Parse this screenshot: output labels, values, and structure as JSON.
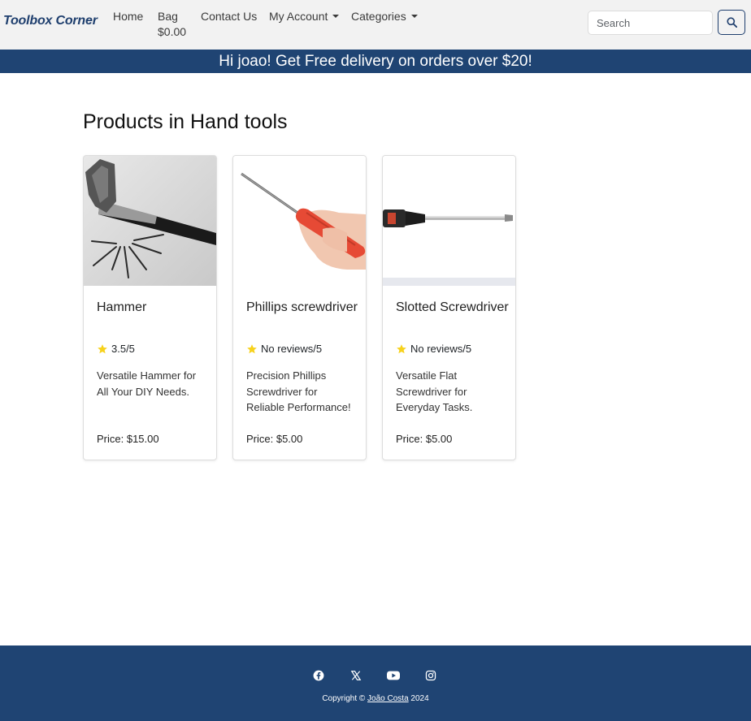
{
  "navbar": {
    "brand": "Toolbox Corner",
    "links": {
      "home": "Home",
      "bag": "Bag",
      "bag_total": "$0.00",
      "contact": "Contact Us",
      "account": "My Account",
      "categories": "Categories"
    },
    "search": {
      "placeholder": "Search",
      "value": ""
    },
    "search_icon": "search-icon"
  },
  "banner": {
    "text": "Hi joao! Get Free delivery on orders over $20!"
  },
  "main": {
    "title": "Products in Hand tools",
    "products": [
      {
        "name": "Hammer",
        "rating": "3.5/5",
        "description": "Versatile Hammer for All Your DIY Needs.",
        "price": "Price: $15.00",
        "image": "hammer-with-nails-photo"
      },
      {
        "name": "Phillips screwdriver",
        "rating": "No reviews/5",
        "description": "Precision Phillips Screwdriver for Reliable Performance!",
        "price": "Price: $5.00",
        "image": "phillips-screwdriver-in-hand-photo"
      },
      {
        "name": "Slotted Screwdriver",
        "rating": "No reviews/5",
        "description": "Versatile Flat Screwdriver for Everyday Tasks.",
        "price": "Price: $5.00",
        "image": "slotted-screwdriver-photo"
      }
    ]
  },
  "footer": {
    "social_icons": [
      "facebook-icon",
      "x-icon",
      "youtube-icon",
      "instagram-icon"
    ],
    "copyright_prefix": "Copyright ©",
    "author": "João Costa",
    "year": "2024"
  },
  "colors": {
    "brand": "#1f3f6e",
    "banner": "#1f4473",
    "navbar_bg": "#f2f2f2",
    "star": "#f7d21c"
  }
}
